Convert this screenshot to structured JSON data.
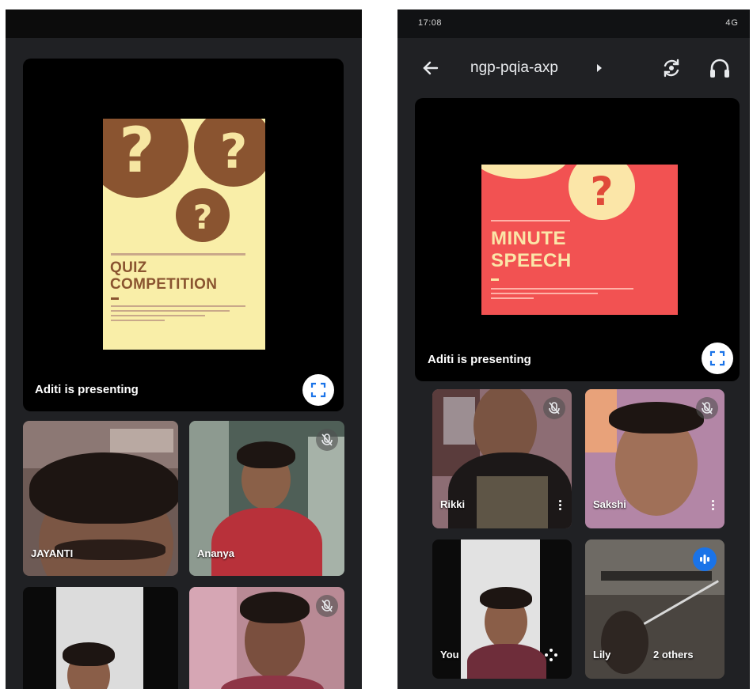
{
  "left_screen": {
    "presentation": {
      "status_text": "Aditi is presenting",
      "slide": {
        "heading_line1": "QUIZ",
        "heading_line2": "COMPETITION",
        "mark": "?"
      }
    },
    "participants": [
      {
        "name": "JAYANTI"
      },
      {
        "name": "Ananya"
      }
    ]
  },
  "right_screen": {
    "status_bar": {
      "time": "17:08",
      "right": "4G"
    },
    "app_bar": {
      "meeting_code": "ngp-pqia-axp"
    },
    "presentation": {
      "status_text": "Aditi is presenting",
      "slide": {
        "heading_line1": "MINUTE",
        "heading_line2": "SPEECH",
        "mark": "?"
      }
    },
    "participants": [
      {
        "name": "Rikki"
      },
      {
        "name": "Sakshi"
      },
      {
        "name": "You"
      },
      {
        "name": "Lily",
        "extra": "2 others"
      }
    ]
  },
  "icons": {
    "back": "arrow-left-icon",
    "switch_camera": "switch-camera-icon",
    "audio": "headphones-icon",
    "fullscreen": "fullscreen-icon",
    "mute": "mic-off-icon",
    "more": "more-vert-icon",
    "speaking": "audio-level-icon"
  },
  "colors": {
    "app_bg": "#202124",
    "quiz_slide_bg": "#f9eea8",
    "quiz_accent": "#8a5430",
    "speech_slide_bg": "#f25252",
    "speech_accent": "#fbe6a8",
    "active_speaker": "#1a73e8"
  }
}
